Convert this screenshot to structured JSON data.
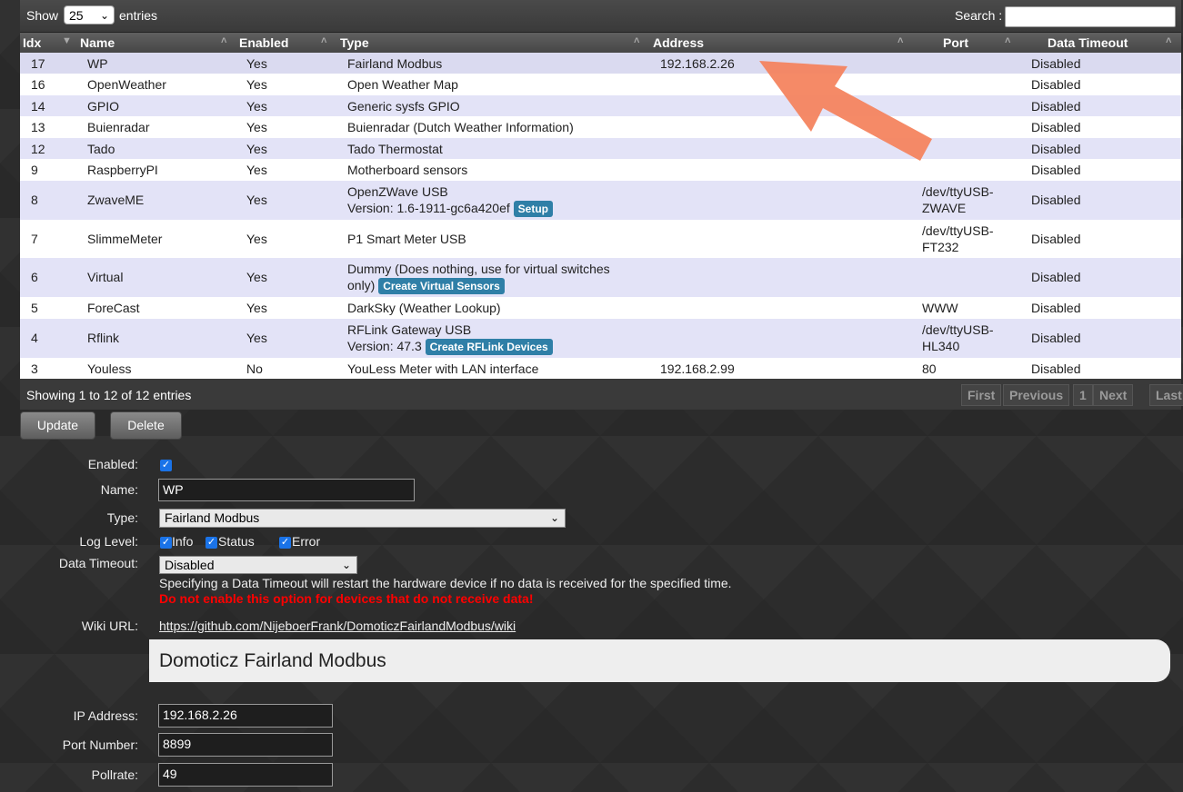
{
  "top": {
    "show_label": "Show",
    "show_value": "25",
    "entries_label": "entries",
    "search_label": "Search :"
  },
  "columns": [
    "Idx",
    "Name",
    "Enabled",
    "Type",
    "Address",
    "Port",
    "Data Timeout"
  ],
  "rows": [
    {
      "idx": "17",
      "name": "WP",
      "enabled": "Yes",
      "type1": "Fairland Modbus",
      "type2": "",
      "button": "",
      "address": "192.168.2.26",
      "port1": "",
      "port2": "",
      "timeout": "Disabled"
    },
    {
      "idx": "16",
      "name": "OpenWeather",
      "enabled": "Yes",
      "type1": "Open Weather Map",
      "type2": "",
      "button": "",
      "address": "",
      "port1": "",
      "port2": "",
      "timeout": "Disabled"
    },
    {
      "idx": "14",
      "name": "GPIO",
      "enabled": "Yes",
      "type1": "Generic sysfs GPIO",
      "type2": "",
      "button": "",
      "address": "",
      "port1": "",
      "port2": "",
      "timeout": "Disabled"
    },
    {
      "idx": "13",
      "name": "Buienradar",
      "enabled": "Yes",
      "type1": "Buienradar (Dutch Weather Information)",
      "type2": "",
      "button": "",
      "address": "",
      "port1": "",
      "port2": "",
      "timeout": "Disabled"
    },
    {
      "idx": "12",
      "name": "Tado",
      "enabled": "Yes",
      "type1": "Tado Thermostat",
      "type2": "",
      "button": "",
      "address": "",
      "port1": "",
      "port2": "",
      "timeout": "Disabled"
    },
    {
      "idx": "9",
      "name": "RaspberryPI",
      "enabled": "Yes",
      "type1": "Motherboard sensors",
      "type2": "",
      "button": "",
      "address": "",
      "port1": "",
      "port2": "",
      "timeout": "Disabled"
    },
    {
      "idx": "8",
      "name": "ZwaveME",
      "enabled": "Yes",
      "type1": "OpenZWave USB",
      "type2": "Version: 1.6-1911-gc6a420ef",
      "button": "Setup",
      "address": "",
      "port1": "/dev/ttyUSB-",
      "port2": "ZWAVE",
      "timeout": "Disabled"
    },
    {
      "idx": "7",
      "name": "SlimmeMeter",
      "enabled": "Yes",
      "type1": "P1 Smart Meter USB",
      "type2": "",
      "button": "",
      "address": "",
      "port1": "/dev/ttyUSB-",
      "port2": "FT232",
      "timeout": "Disabled"
    },
    {
      "idx": "6",
      "name": "Virtual",
      "enabled": "Yes",
      "type1": "Dummy (Does nothing, use for virtual switches",
      "type2": "only)",
      "button": "Create Virtual Sensors",
      "address": "",
      "port1": "",
      "port2": "",
      "timeout": "Disabled"
    },
    {
      "idx": "5",
      "name": "ForeCast",
      "enabled": "Yes",
      "type1": "DarkSky (Weather Lookup)",
      "type2": "",
      "button": "",
      "address": "",
      "port1": "WWW",
      "port2": "",
      "timeout": "Disabled"
    },
    {
      "idx": "4",
      "name": "Rflink",
      "enabled": "Yes",
      "type1": "RFLink Gateway USB",
      "type2": "Version: 47.3",
      "button": "Create RFLink Devices",
      "address": "",
      "port1": "/dev/ttyUSB-",
      "port2": "HL340",
      "timeout": "Disabled"
    },
    {
      "idx": "3",
      "name": "Youless",
      "enabled": "No",
      "type1": "YouLess Meter with LAN interface",
      "type2": "",
      "button": "",
      "address": "192.168.2.99",
      "port1": "80",
      "port2": "",
      "timeout": "Disabled"
    }
  ],
  "footer": {
    "showing": "Showing 1 to 12 of 12 entries",
    "first": "First",
    "previous": "Previous",
    "page": "1",
    "next": "Next",
    "last": "Last"
  },
  "actions": {
    "update": "Update",
    "delete": "Delete"
  },
  "form": {
    "enabled_label": "Enabled:",
    "name_label": "Name:",
    "name_value": "WP",
    "type_label": "Type:",
    "type_value": "Fairland Modbus",
    "loglevel_label": "Log Level:",
    "log_info": "Info",
    "log_status": "Status",
    "log_error": "Error",
    "timeout_label": "Data Timeout:",
    "timeout_value": "Disabled",
    "timeout_note": "Specifying a Data Timeout will restart the hardware device if no data is received for the specified time.",
    "timeout_warning": "Do not enable this option for devices that do not receive data!",
    "wiki_label": "Wiki URL:",
    "wiki_url": "https://github.com/NijeboerFrank/DomoticzFairlandModbus/wiki",
    "plugin_title": "Domoticz Fairland Modbus",
    "ip_label": "IP Address:",
    "ip_value": "192.168.2.26",
    "port_label": "Port Number:",
    "port_value": "8899",
    "pollrate_label": "Pollrate:",
    "pollrate_value": "49"
  },
  "colors": {
    "row_odd": "#e3e3f7",
    "row_even": "#ffffff",
    "badge": "#2f7fa7",
    "warning": "#ff0000",
    "arrow": "#f4845f"
  }
}
